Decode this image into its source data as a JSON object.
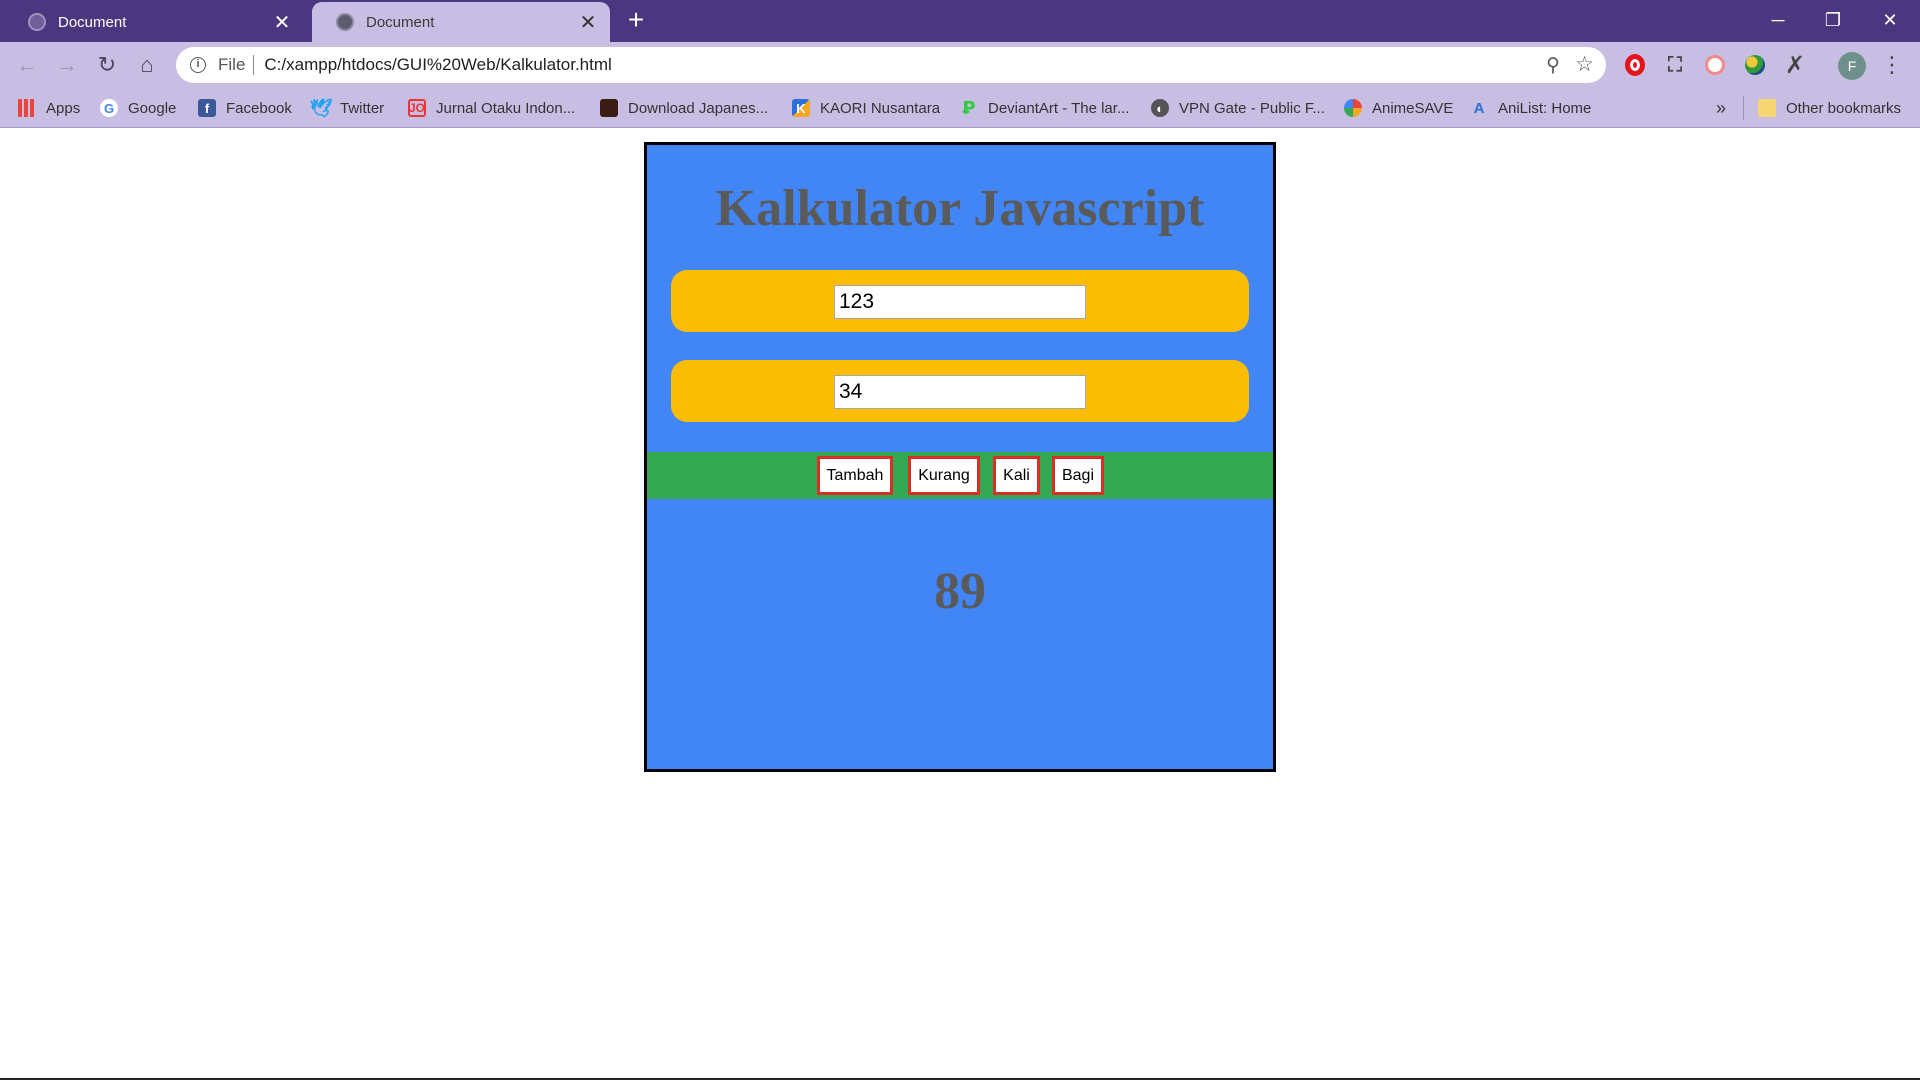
{
  "browser": {
    "tabs": [
      {
        "title": "Document",
        "active": false
      },
      {
        "title": "Document",
        "active": true
      }
    ],
    "new_tab_icon": "+",
    "window_controls": {
      "minimize": "─",
      "maximize": "❐",
      "close": "✕"
    },
    "toolbar": {
      "back_icon": "←",
      "forward_icon": "→",
      "reload_icon": "↻",
      "home_icon": "⌂",
      "file_label": "File",
      "url": "C:/xampp/htdocs/GUI%20Web/Kalkulator.html",
      "zoom_icon": "⚲",
      "star_icon": "☆",
      "profile_initial": "F",
      "menu_icon": "⋮"
    },
    "bookmarks": [
      {
        "label": "Apps",
        "icon": "apps-grid-icon"
      },
      {
        "label": "Google",
        "icon": "google-icon",
        "glyph": "G"
      },
      {
        "label": "Facebook",
        "icon": "facebook-icon",
        "glyph": "f"
      },
      {
        "label": "Twitter",
        "icon": "twitter-icon",
        "glyph": "🕊"
      },
      {
        "label": "Jurnal Otaku Indon...",
        "icon": "jurnal-otaku-icon",
        "glyph": "JO"
      },
      {
        "label": "Download Japanes...",
        "icon": "download-japanese-icon"
      },
      {
        "label": "KAORI Nusantara",
        "icon": "kaori-icon",
        "glyph": "K"
      },
      {
        "label": "DeviantArt - The lar...",
        "icon": "deviantart-icon",
        "glyph": "Ꝑ"
      },
      {
        "label": "VPN Gate - Public F...",
        "icon": "vpn-gate-icon",
        "glyph": "◐"
      },
      {
        "label": "AnimeSAVE",
        "icon": "animesave-icon"
      },
      {
        "label": "AniList: Home",
        "icon": "anilist-icon",
        "glyph": "A"
      }
    ],
    "bookmarks_more": "»",
    "other_bookmarks": "Other bookmarks",
    "colors": {
      "frame": "#4b3680",
      "toolbar": "#c8bee3"
    }
  },
  "page": {
    "title": "Kalkulator Javascript",
    "input1": "123",
    "input2": "34",
    "buttons": {
      "add": "Tambah",
      "subtract": "Kurang",
      "multiply": "Kali",
      "divide": "Bagi"
    },
    "result": "89",
    "colors": {
      "panel": "#4285f4",
      "input_band": "#fbbc04",
      "button_band": "#34a853",
      "button_border": "#d93025",
      "text": "#5a5a5a"
    }
  }
}
